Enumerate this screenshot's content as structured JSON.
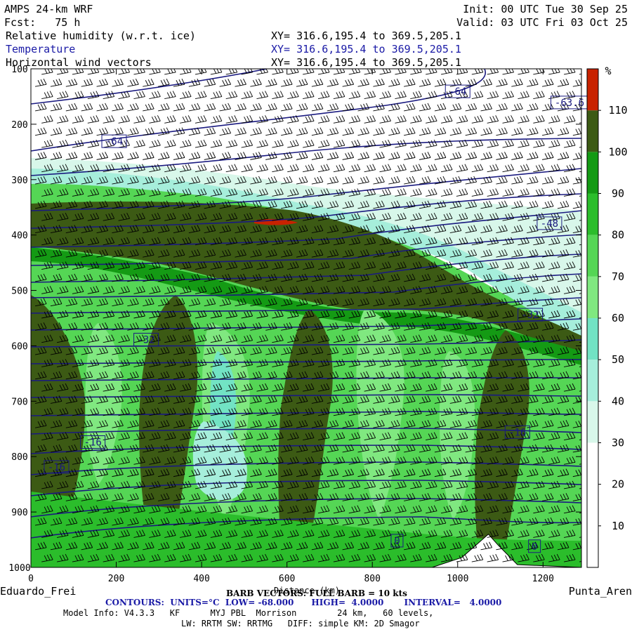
{
  "header": {
    "model": "AMPS 24-km WRF",
    "fcst": "Fcst:   75 h",
    "init": "Init: 00 UTC Tue 30 Sep 25",
    "valid": "Valid: 03 UTC Fri 03 Oct 25",
    "field1": "Relative humidity (w.r.t. ice)",
    "field2": "Temperature",
    "field3": "Horizontal wind vectors",
    "xy1": "XY= 316.6,195.4 to 369.5,205.1",
    "xy2": "XY= 316.6,195.4 to 369.5,205.1",
    "xy3": "XY= 316.6,195.4 to 369.5,205.1"
  },
  "footer": {
    "left_station": "Eduardo_Frei",
    "right_station": "Punta_Aren",
    "xlabel": "Distance (km)",
    "barb": "BARB VECTORS: FULL BARB = 10 kts",
    "contours": "CONTOURS:  UNITS=°C  LOW= -68.000      HIGH=  4.0000       INTERVAL=   4.0000",
    "model_info": "Model Info: V4.3.3   KF      MYJ PBL  Morrison        24 km,   60 levels,",
    "physics": "LW: RRTM SW: RRTMG   DIFF: simple KM: 2D Smagor"
  },
  "chart_data": {
    "type": "heatmap",
    "xlabel": "Distance (km)",
    "ylabel": "",
    "xlim": [
      0,
      1290
    ],
    "ylim": [
      1000,
      100
    ],
    "x_ticks": [
      0,
      200,
      400,
      600,
      800,
      1000,
      1200
    ],
    "y_ticks": [
      100,
      200,
      300,
      400,
      500,
      600,
      700,
      800,
      900,
      1000
    ],
    "colorbar": {
      "unit": "%",
      "ticks": [
        10,
        20,
        30,
        40,
        50,
        60,
        70,
        80,
        90,
        100,
        110
      ],
      "levels": [
        0,
        30,
        40,
        50,
        60,
        70,
        80,
        90,
        100,
        110,
        120
      ],
      "colors": [
        "#ffffff",
        "#d8f7ea",
        "#a6eedb",
        "#72e3c4",
        "#80e880",
        "#55d655",
        "#2bbd2b",
        "#149a14",
        "#3c5a14",
        "#c82200"
      ]
    },
    "contour_labels": [
      {
        "text": "-64",
        "x": 1000,
        "p": 142
      },
      {
        "text": "-63.6",
        "x": 1262,
        "p": 162
      },
      {
        "text": "-64",
        "x": 195,
        "p": 232
      },
      {
        "text": "-48",
        "x": 1215,
        "p": 380
      },
      {
        "text": "-32",
        "x": 1170,
        "p": 545
      },
      {
        "text": "-32",
        "x": 270,
        "p": 590
      },
      {
        "text": "-16",
        "x": 145,
        "p": 775
      },
      {
        "text": "-16",
        "x": 60,
        "p": 820
      },
      {
        "text": "-16",
        "x": 1140,
        "p": 757
      },
      {
        "text": "0",
        "x": 858,
        "p": 953
      },
      {
        "text": "0",
        "x": 1180,
        "p": 963
      }
    ],
    "terrain": [
      {
        "x": 0,
        "p": 1000
      },
      {
        "x": 940,
        "p": 1000
      },
      {
        "x": 1010,
        "p": 982
      },
      {
        "x": 1050,
        "p": 955
      },
      {
        "x": 1072,
        "p": 940
      },
      {
        "x": 1095,
        "p": 960
      },
      {
        "x": 1140,
        "p": 995
      },
      {
        "x": 1290,
        "p": 1000
      }
    ],
    "rh_regions": [
      {
        "level": "gt110",
        "points": [
          [
            540,
            370
          ],
          [
            600,
            365
          ],
          [
            630,
            372
          ],
          [
            580,
            378
          ],
          [
            540,
            375
          ]
        ]
      },
      {
        "level": "c30",
        "points": [
          [
            0,
            260
          ],
          [
            1290,
            260
          ],
          [
            1290,
            480
          ],
          [
            900,
            470
          ],
          [
            700,
            400
          ],
          [
            400,
            300
          ],
          [
            0,
            290
          ]
        ]
      }
    ]
  }
}
